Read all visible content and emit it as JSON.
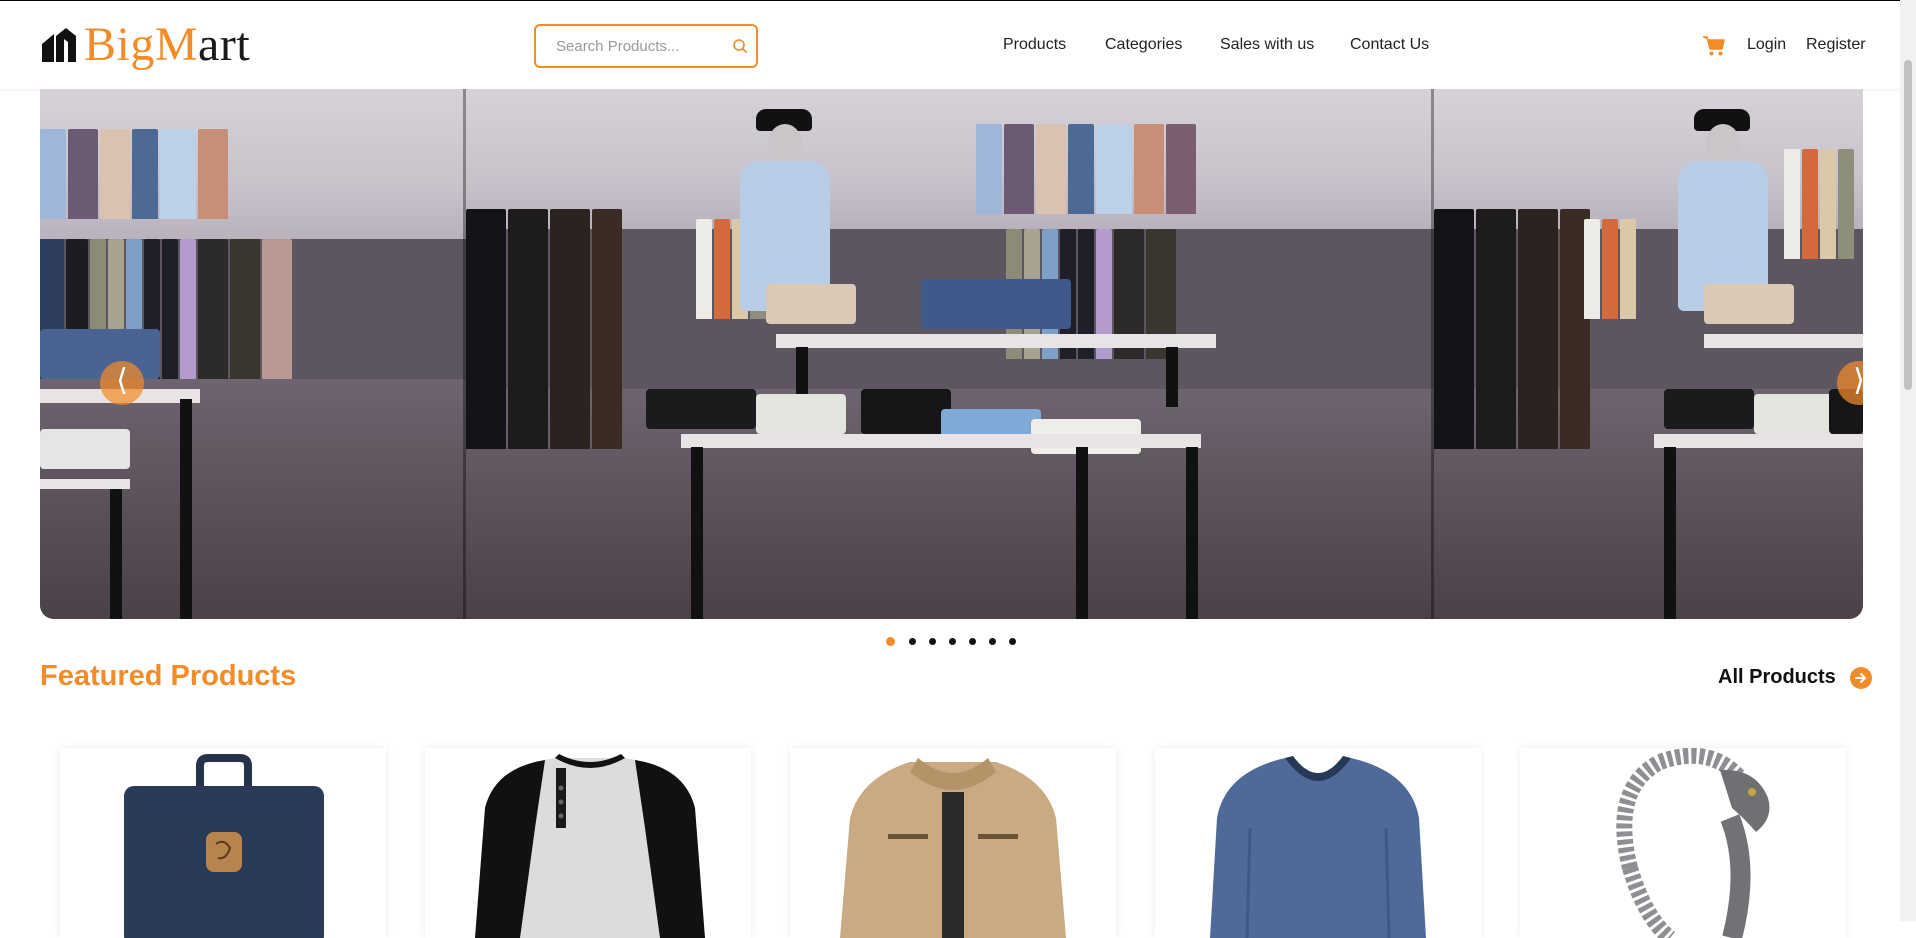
{
  "brand": {
    "part1": "Big",
    "part2": "M",
    "part3": "art"
  },
  "search": {
    "placeholder": "Search Products..."
  },
  "nav": [
    {
      "label": "Products"
    },
    {
      "label": "Categories"
    },
    {
      "label": "Sales with us"
    },
    {
      "label": "Contact Us"
    }
  ],
  "account": {
    "login": "Login",
    "register": "Register"
  },
  "carousel": {
    "prev_label": "⟨",
    "next_label": "⟩",
    "slide_count": 7,
    "active_slide": 1
  },
  "featured": {
    "title": "Featured Products",
    "all_label": "All Products",
    "products": [
      {
        "icon": "bag-icon"
      },
      {
        "icon": "henley-shirt-icon"
      },
      {
        "icon": "jacket-icon"
      },
      {
        "icon": "vneck-shirt-icon"
      },
      {
        "icon": "bracelet-icon"
      }
    ]
  },
  "colors": {
    "accent": "#f28c28",
    "text": "#222222"
  }
}
